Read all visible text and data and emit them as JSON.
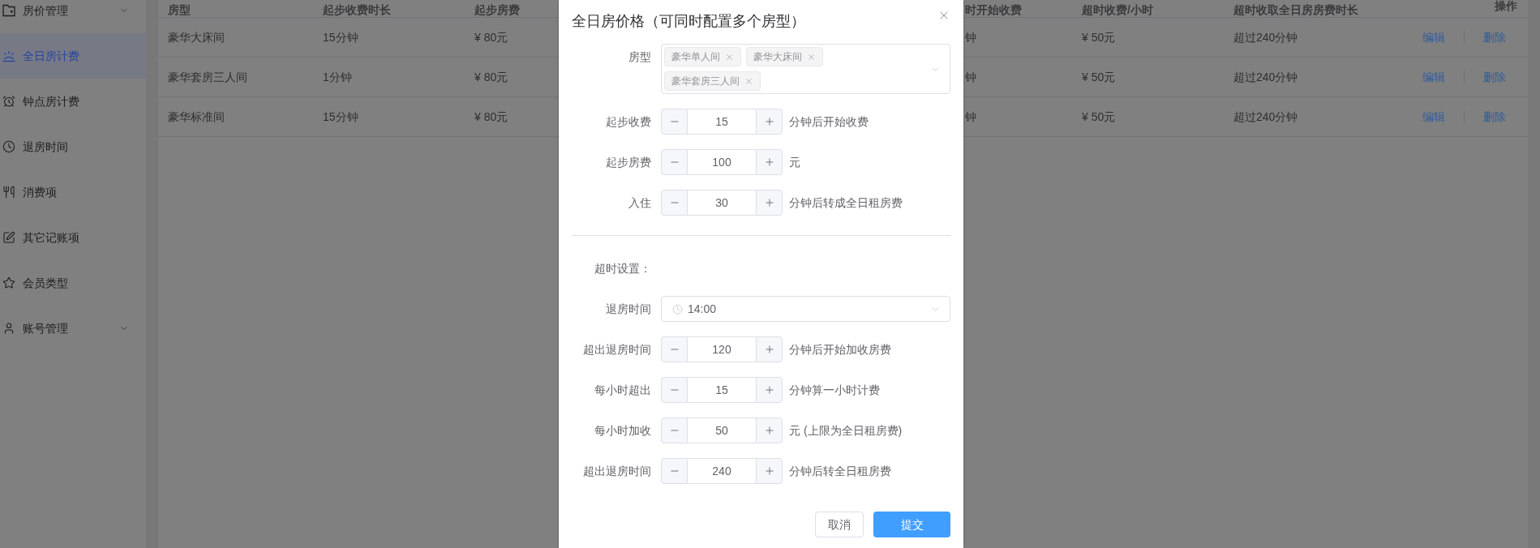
{
  "sidebar": {
    "items": [
      {
        "label": "房价管理",
        "kind": "submenu",
        "selected": false
      },
      {
        "label": "全日房计费",
        "kind": "item",
        "selected": true
      },
      {
        "label": "钟点房计费",
        "kind": "item",
        "selected": false
      },
      {
        "label": "退房时间",
        "kind": "item",
        "selected": false
      },
      {
        "label": "消费项",
        "kind": "item",
        "selected": false
      },
      {
        "label": "其它记账项",
        "kind": "item",
        "selected": false
      },
      {
        "label": "会员类型",
        "kind": "item",
        "selected": false
      },
      {
        "label": "账号管理",
        "kind": "submenu",
        "selected": false
      }
    ]
  },
  "table": {
    "columns": [
      "房型",
      "起步收费时长",
      "起步房费",
      "时开始收费",
      "超时收费/小时",
      "超时收取全日房房费时长",
      "操作"
    ],
    "rows": [
      {
        "cells": [
          "豪华大床间",
          "15分钟",
          "¥ 80元",
          "钟",
          "¥ 50元",
          "超过240分钟"
        ],
        "actions": [
          "编辑",
          "删除"
        ]
      },
      {
        "cells": [
          "豪华套房三人间",
          "1分钟",
          "¥ 80元",
          "钟",
          "¥ 50元",
          "超过240分钟"
        ],
        "actions": [
          "编辑",
          "删除"
        ]
      },
      {
        "cells": [
          "豪华标准间",
          "15分钟",
          "¥ 80元",
          "钟",
          "¥ 50元",
          "超过240分钟"
        ],
        "actions": [
          "编辑",
          "删除"
        ]
      }
    ]
  },
  "dialog": {
    "title": "全日房价格（可同时配置多个房型）",
    "room_type": {
      "label": "房型",
      "tags": [
        "豪华单人间",
        "豪华大床间",
        "豪华套房三人间"
      ]
    },
    "fields": [
      {
        "kind": "number",
        "label": "起步收费",
        "value": "15",
        "suffix": "分钟后开始收费"
      },
      {
        "kind": "number",
        "label": "起步房费",
        "value": "100",
        "suffix": "元"
      },
      {
        "kind": "number",
        "label": "入住",
        "value": "30",
        "suffix": "分钟后转成全日租房费"
      }
    ],
    "overtime": {
      "heading": "超时设置：",
      "fields": [
        {
          "kind": "time",
          "label": "退房时间",
          "value": "14:00"
        },
        {
          "kind": "number",
          "label": "超出退房时间",
          "value": "120",
          "suffix": "分钟后开始加收房费"
        },
        {
          "kind": "number",
          "label": "每小时超出",
          "value": "15",
          "suffix": "分钟算一小时计费"
        },
        {
          "kind": "number",
          "label": "每小时加收",
          "value": "50",
          "suffix": "元 (上限为全日租房费)"
        },
        {
          "kind": "number",
          "label": "超出退房时间",
          "value": "240",
          "suffix": "分钟后转全日租房费"
        }
      ]
    },
    "buttons": [
      {
        "label": "取消",
        "kind": "default"
      },
      {
        "label": "提交",
        "kind": "primary"
      }
    ]
  }
}
